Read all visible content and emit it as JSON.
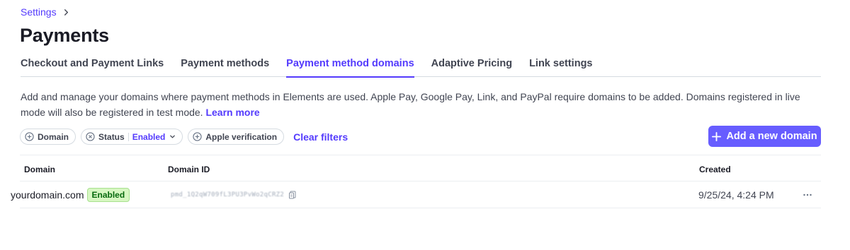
{
  "breadcrumb": {
    "parent": "Settings"
  },
  "page": {
    "title": "Payments"
  },
  "tabs": [
    {
      "label": "Checkout and Payment Links"
    },
    {
      "label": "Payment methods"
    },
    {
      "label": "Payment method domains"
    },
    {
      "label": "Adaptive Pricing"
    },
    {
      "label": "Link settings"
    }
  ],
  "active_tab": "Payment method domains",
  "description": {
    "text": "Add and manage your domains where payment methods in Elements are used. Apple Pay, Google Pay, Link, and PayPal require domains to be added. Domains registered in live mode will also be registered in test mode.",
    "link": "Learn more"
  },
  "filters": {
    "domain": "Domain",
    "status_label": "Status",
    "status_value": "Enabled",
    "apple_verification": "Apple verification",
    "clear": "Clear filters"
  },
  "add_button": {
    "label": "Add a new domain"
  },
  "table": {
    "columns": {
      "domain": "Domain",
      "domain_id": "Domain ID",
      "created": "Created"
    },
    "rows": [
      {
        "domain": "yourdomain.com",
        "status": "Enabled",
        "domain_id": "pmd_1Q2qW709fL3PU3PvWo2qCRZ2",
        "created": "9/25/24, 4:24 PM"
      }
    ]
  },
  "colors": {
    "accent": "#533afd",
    "button": "#675dff",
    "badge_bg": "#d7f7c2",
    "badge_text": "#05690d"
  },
  "icons": [
    "chevron-right-icon",
    "plus-circle-icon",
    "x-circle-icon",
    "chevron-down-icon",
    "plus-icon",
    "copy-icon",
    "more-horizontal-icon"
  ]
}
